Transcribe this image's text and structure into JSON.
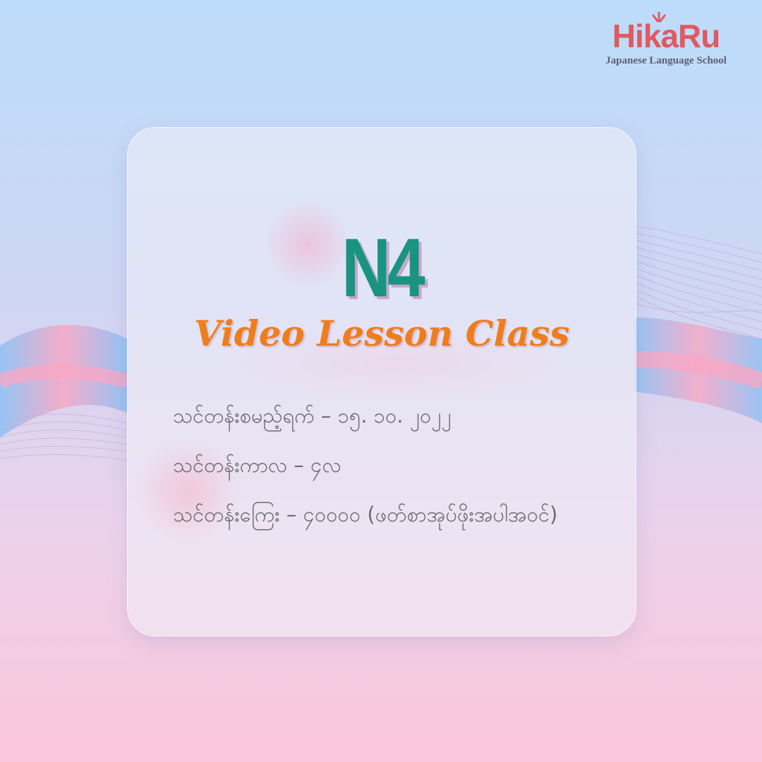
{
  "logo": {
    "name": "HikaRu",
    "tagline": "Japanese Language School"
  },
  "course": {
    "level": "N4",
    "title": "Video Lesson Class"
  },
  "details": [
    {
      "text": "သင်တန်းစမည့်ရက် – ၁၅. ၁၀. ၂၀၂၂"
    },
    {
      "text": "သင်တန်းကာလ – ၄လ"
    },
    {
      "text": "သင်တန်းကြေး – ၄၀၀၀၀ (ဖတ်စာအုပ်ဖိုးအပါအဝင်)"
    }
  ],
  "colors": {
    "level": "#1a9482",
    "title": "#f07d1c",
    "logo": "#e05a5e",
    "body_text": "#6c6c72"
  }
}
